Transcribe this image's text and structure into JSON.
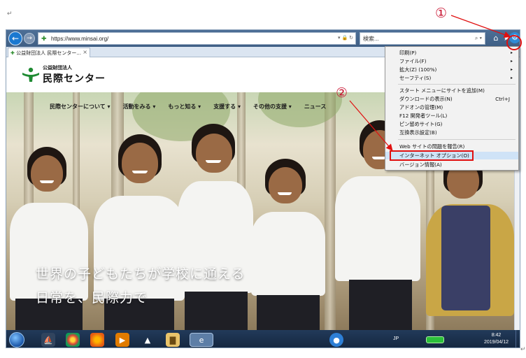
{
  "browser": {
    "url": "https://www.minsai.org/",
    "search_placeholder": "検索...",
    "tab_title": "公益財団法人 民際センター..."
  },
  "site": {
    "logo_line1": "公益財団法人",
    "logo_line2": "民際センター",
    "nav": [
      "民際センターについて ▾",
      "活動をみる ▾",
      "もっと知る ▾",
      "支援する ▾",
      "その他の支援 ▾",
      "ニュース"
    ],
    "hero_line1": "世界の子どもたちが学校に通える",
    "hero_line2": "日常を、民際力で"
  },
  "tools_menu": {
    "items": [
      {
        "label": "印刷(P)",
        "arrow": "▸",
        "shortcut": ""
      },
      {
        "label": "ファイル(F)",
        "arrow": "▸",
        "shortcut": ""
      },
      {
        "label": "拡大(Z) (100%)",
        "arrow": "▸",
        "shortcut": ""
      },
      {
        "label": "セーフティ(S)",
        "arrow": "▸",
        "shortcut": ""
      },
      {
        "label": "スタート メニューにサイトを追加(M)",
        "arrow": "",
        "shortcut": ""
      },
      {
        "label": "ダウンロードの表示(N)",
        "arrow": "",
        "shortcut": "Ctrl+J"
      },
      {
        "label": "アドオンの管理(M)",
        "arrow": "",
        "shortcut": ""
      },
      {
        "label": "F12 開発者ツール(L)",
        "arrow": "",
        "shortcut": ""
      },
      {
        "label": "ピン留めサイト(G)",
        "arrow": "",
        "shortcut": ""
      },
      {
        "label": "互換表示設定(B)",
        "arrow": "",
        "shortcut": ""
      },
      {
        "label": "Web サイトの問題を報告(R)",
        "arrow": "",
        "shortcut": ""
      },
      {
        "label": "インターネット オプション(O)",
        "arrow": "",
        "shortcut": ""
      },
      {
        "label": "バージョン情報(A)",
        "arrow": "",
        "shortcut": ""
      }
    ]
  },
  "annotations": {
    "step1": "①",
    "step2": "②"
  },
  "taskbar": {
    "lang": "JP",
    "time": "8:42",
    "date": "2019/04/12"
  },
  "doc_marks": {
    "top_left": "↵",
    "bottom_right": "↵"
  },
  "colors": {
    "annotation_red": "#e01010",
    "address_bar": "#4d6f96",
    "highlight": "#cfe3f7"
  }
}
